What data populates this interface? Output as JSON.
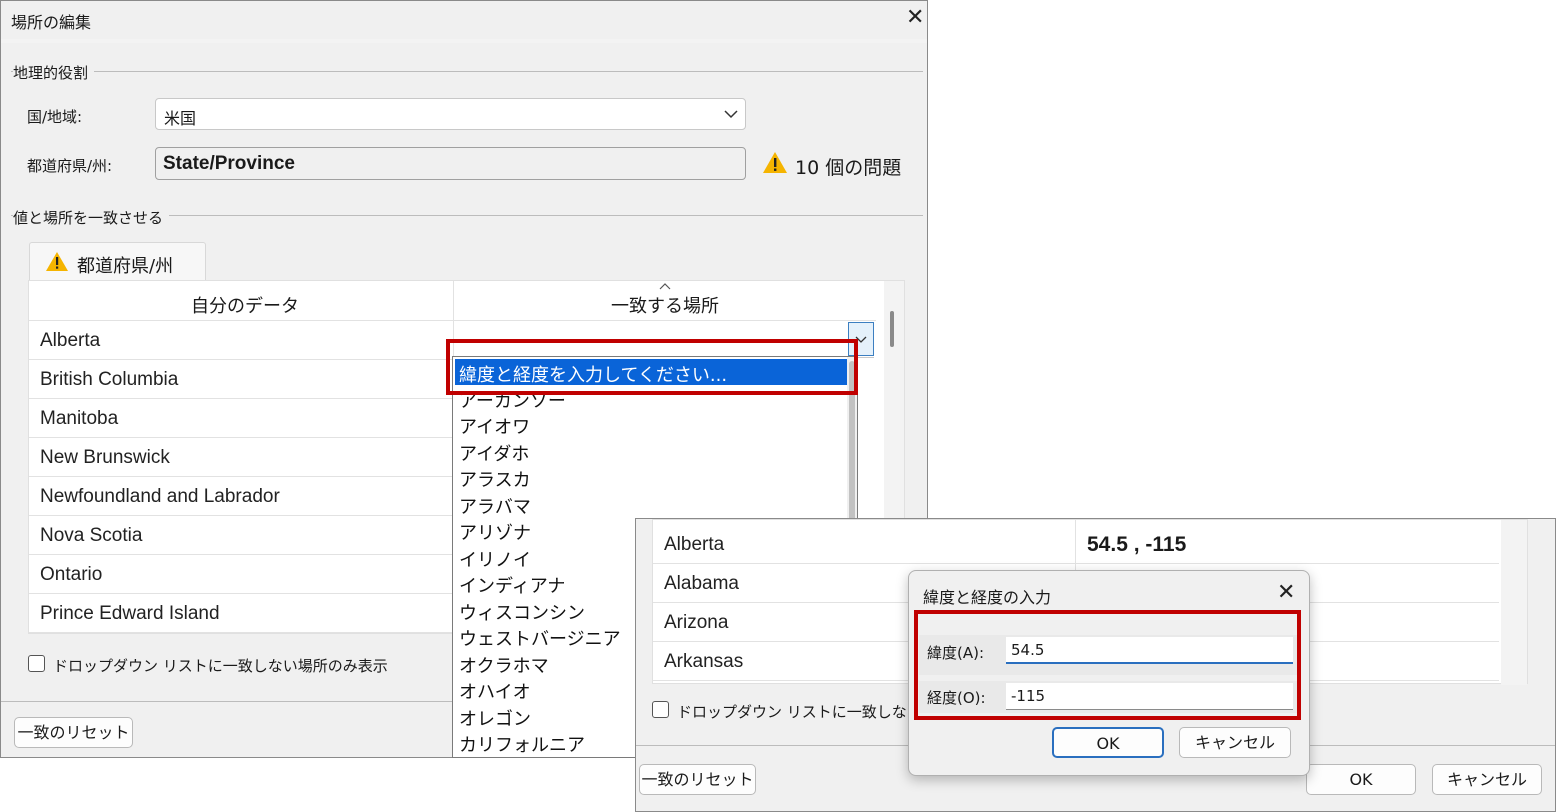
{
  "main_dialog": {
    "title": "場所の編集",
    "geo_group_label": "地理的役割",
    "country_label": "国/地域:",
    "country_value": "米国",
    "state_label": "都道府県/州:",
    "state_value": "State/Province",
    "issues_text": "10 個の問題",
    "match_group_label": "値と場所を一致させる",
    "tab_label": "都道府県/州",
    "col_mydata": "自分のデータ",
    "col_match": "一致する場所",
    "rows": [
      "Alberta",
      "British Columbia",
      "Manitoba",
      "New Brunswick",
      "Newfoundland and Labrador",
      "Nova Scotia",
      "Ontario",
      "Prince Edward Island"
    ],
    "checkbox_label": "ドロップダウン リストに一致しない場所のみ表示",
    "reset_button": "一致のリセット"
  },
  "dropdown": {
    "highlight_item": "緯度と経度を入力してください...",
    "items": [
      "アーカンソー",
      "アイオワ",
      "アイダホ",
      "アラスカ",
      "アラバマ",
      "アリゾナ",
      "イリノイ",
      "インディアナ",
      "ウィスコンシン",
      "ウェストバージニア",
      "オクラホマ",
      "オハイオ",
      "オレゴン",
      "カリフォルニア"
    ]
  },
  "second_dialog": {
    "rows": [
      {
        "name": "Alberta",
        "value": "54.5 , -115"
      },
      {
        "name": "Alabama",
        "value": ""
      },
      {
        "name": "Arizona",
        "value": ""
      },
      {
        "name": "Arkansas",
        "value": ""
      }
    ],
    "checkbox_label": "ドロップダウン リストに一致しない場",
    "reset_button": "一致のリセット",
    "ok_button": "OK",
    "cancel_button": "キャンセル"
  },
  "latlon_dialog": {
    "title": "緯度と経度の入力",
    "lat_label": "緯度(A):",
    "lat_value": "54.5",
    "lon_label": "経度(O):",
    "lon_value": "-115",
    "ok_button": "OK",
    "cancel_button": "キャンセル"
  },
  "colors": {
    "highlight": "#0a64d8",
    "annotation_red": "#c00000",
    "warning": "#f5b400"
  },
  "icons": [
    "close-icon",
    "chevron-down-icon",
    "warning-icon",
    "sort-up-icon"
  ]
}
